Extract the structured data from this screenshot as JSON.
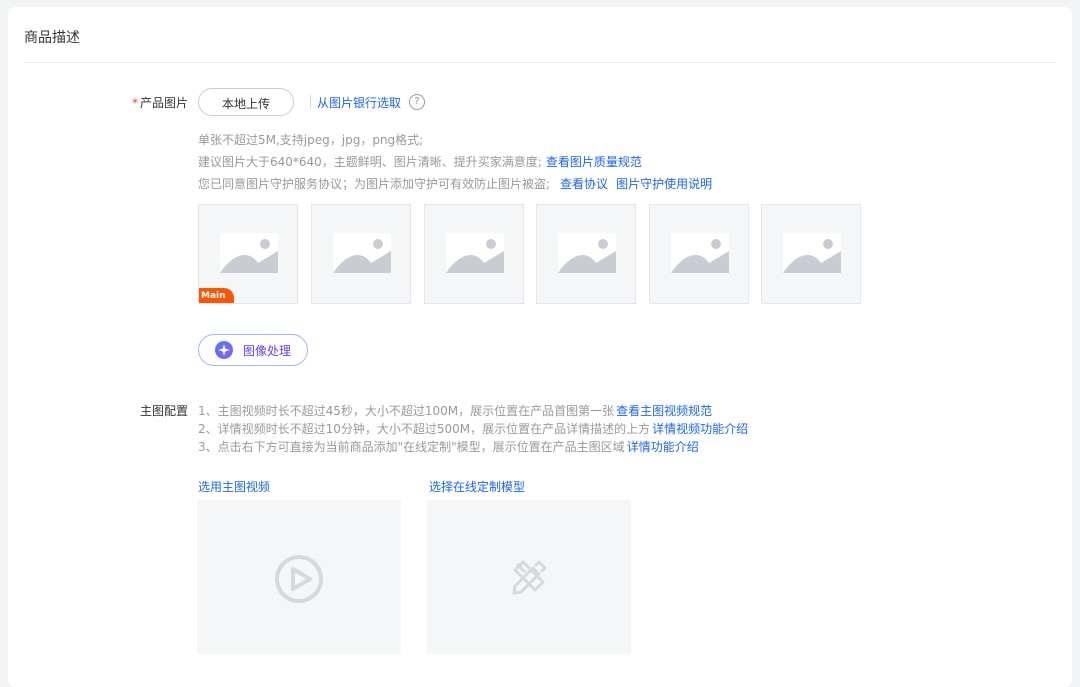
{
  "section": {
    "title": "商品描述"
  },
  "product_images": {
    "label": "产品图片",
    "required_mark": "*",
    "upload_button": "本地上传",
    "bank_link": "从图片银行选取",
    "help": "?",
    "hints": {
      "line1": "单张不超过5M,支持jpeg，jpg，png格式;",
      "line2_text": "建议图片大于640*640，主题鲜明、图片清晰、提升买家满意度;",
      "line2_link": "查看图片质量规范",
      "line3_text": "您已同意图片守护服务协议；为图片添加守护可有效防止图片被盗;",
      "line3_link1": "查看协议",
      "line3_link2": "图片守护使用说明"
    },
    "main_tag": "Main",
    "image_process_button": "图像处理"
  },
  "main_config": {
    "label": "主图配置",
    "rules": [
      {
        "text": "1、主图视频时长不超过45秒，大小不超过100M，展示位置在产品首图第一张",
        "link": "查看主图视频规范"
      },
      {
        "text": "2、详情视频时长不超过10分钟，大小不超过500M，展示位置在产品详情描述的上方",
        "link": "详情视频功能介绍"
      },
      {
        "text": "3、点击右下方可直接为当前商品添加\"在线定制\"模型，展示位置在产品主图区域",
        "link": "详情功能介绍"
      }
    ],
    "select_video": "选用主图视频",
    "select_model": "选择在线定制模型"
  },
  "colors": {
    "link": "#1a66ff",
    "required": "#ff3b30",
    "main_tag": "#ff5500",
    "accent_purple": "#6a3cff"
  }
}
